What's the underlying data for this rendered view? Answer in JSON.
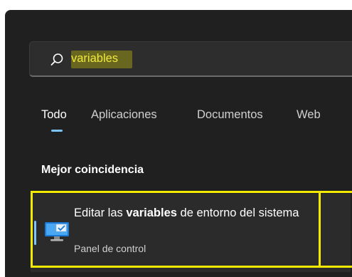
{
  "search": {
    "value": "variables",
    "placeholder": ""
  },
  "tabs": [
    {
      "label": "Todo",
      "active": true
    },
    {
      "label": "Aplicaciones",
      "active": false
    },
    {
      "label": "Documentos",
      "active": false
    },
    {
      "label": "Web",
      "active": false
    }
  ],
  "section": {
    "best_match_title": "Mejor coincidencia"
  },
  "result": {
    "title_before": "Editar las ",
    "title_bold": "variables",
    "title_after": " de entorno del sistema",
    "subtitle": "Panel de control",
    "icon": "system-settings-monitor-icon"
  },
  "colors": {
    "panel_bg": "#202020",
    "accent": "#7cc4f8",
    "annotation": "#f4ea00"
  }
}
